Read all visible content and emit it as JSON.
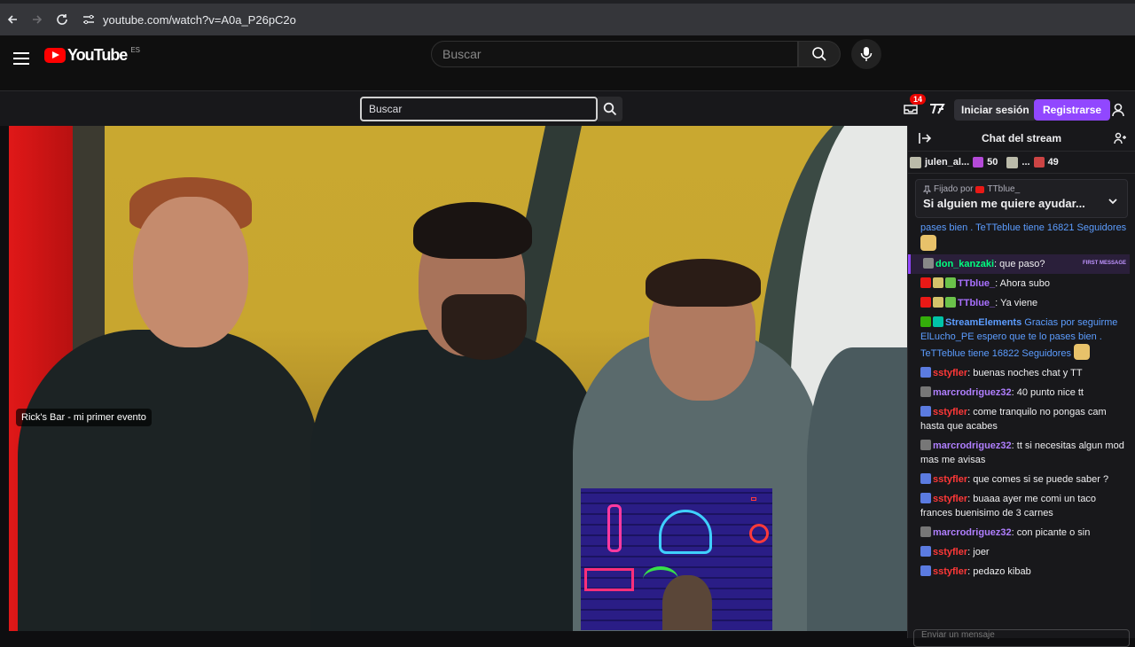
{
  "browser": {
    "url": "youtube.com/watch?v=A0a_P26pC2o"
  },
  "youtube": {
    "logo_text": "YouTube",
    "region": "ES",
    "search_placeholder": "Buscar"
  },
  "twitch": {
    "search_placeholder": "Buscar",
    "notification_count": "14",
    "login_label": "Iniciar sesión",
    "register_label": "Registrarse",
    "brand_color": "#9147ff"
  },
  "video": {
    "label": "Rick's Bar - mi primer evento"
  },
  "chat": {
    "title": "Chat del stream",
    "leaders": [
      {
        "name": "julen_al...",
        "value": "50"
      },
      {
        "name": "...",
        "value": "49"
      }
    ],
    "pinned": {
      "by_prefix": "Fijado por",
      "by_user": "TTblue_",
      "text": "Si alguien me quiere ayudar..."
    },
    "first_message_tag": "FIRST MESSAGE",
    "messages": [
      {
        "user": "",
        "text": "pases bien . TeTTeblue tiene 16821 Seguidores",
        "color": "#5c9dff"
      },
      {
        "user": "don_kanzaki",
        "text": ": que paso?",
        "color": "#00ff7f",
        "first": true
      },
      {
        "user": "TTblue_",
        "text": ": Ahora subo",
        "color": "#a970ff"
      },
      {
        "user": "TTblue_",
        "text": ": Ya viene",
        "color": "#a970ff"
      },
      {
        "user": "StreamElements",
        "text": " Gracias por seguirme ElLucho_PE espero que te lo pases bien . TeTTeblue tiene 16822 Seguidores",
        "color": "#5c9dff"
      },
      {
        "user": "sstyfler",
        "text": ": buenas noches chat y TT",
        "color": "#ff3838"
      },
      {
        "user": "marcrodriguez32",
        "text": ": 40 punto nice tt",
        "color": "#b07fff"
      },
      {
        "user": "sstyfler",
        "text": ": come tranquilo no pongas cam hasta que acabes",
        "color": "#ff3838"
      },
      {
        "user": "marcrodriguez32",
        "text": ": tt si necesitas algun mod mas me avisas",
        "color": "#b07fff"
      },
      {
        "user": "sstyfler",
        "text": ": que comes si se puede saber ?",
        "color": "#ff3838"
      },
      {
        "user": "sstyfler",
        "text": ": buaaa ayer me comi un taco frances buenisimo de 3 carnes",
        "color": "#ff3838"
      },
      {
        "user": "marcrodriguez32",
        "text": ": con picante o sin",
        "color": "#b07fff"
      },
      {
        "user": "sstyfler",
        "text": ": joer",
        "color": "#ff3838"
      },
      {
        "user": "sstyfler",
        "text": ": pedazo kibab",
        "color": "#ff3838"
      }
    ],
    "input_placeholder": "Enviar un mensaje"
  }
}
